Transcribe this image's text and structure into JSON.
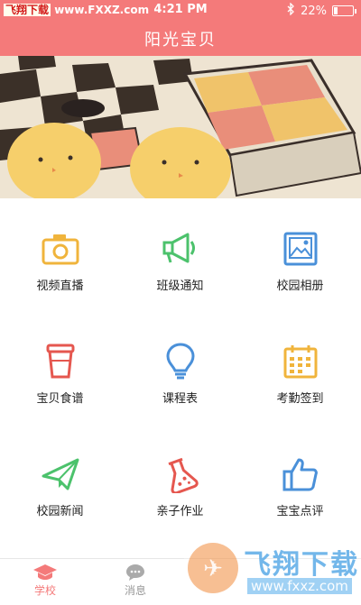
{
  "status": {
    "watermark_site": "飞翔下载",
    "watermark_url": "www.FXXZ.com",
    "time": "4:21 PM",
    "battery": "22%",
    "battery_level": 0.22
  },
  "header": {
    "title": "阳光宝贝"
  },
  "grid": {
    "items": [
      {
        "label": "视频直播",
        "icon": "camera-icon"
      },
      {
        "label": "班级通知",
        "icon": "megaphone-icon"
      },
      {
        "label": "校园相册",
        "icon": "photo-album-icon"
      },
      {
        "label": "宝贝食谱",
        "icon": "cup-icon"
      },
      {
        "label": "课程表",
        "icon": "lightbulb-icon"
      },
      {
        "label": "考勤签到",
        "icon": "calendar-icon"
      },
      {
        "label": "校园新闻",
        "icon": "paper-plane-icon"
      },
      {
        "label": "亲子作业",
        "icon": "flask-icon"
      },
      {
        "label": "宝宝点评",
        "icon": "thumbs-up-icon"
      }
    ]
  },
  "tabbar": {
    "tabs": [
      {
        "label": "学校",
        "icon": "graduation-cap-icon",
        "active": true
      },
      {
        "label": "消息",
        "icon": "chat-bubble-icon",
        "active": false
      }
    ]
  },
  "bottom_watermark": {
    "brand": "飞翔下载",
    "url": "www.fxxz.com"
  },
  "colors": {
    "accent": "#f47a7a",
    "icon_orange": "#f0b43c",
    "icon_green": "#4cc26c",
    "icon_blue": "#4a90d9",
    "icon_red": "#e5574f"
  }
}
